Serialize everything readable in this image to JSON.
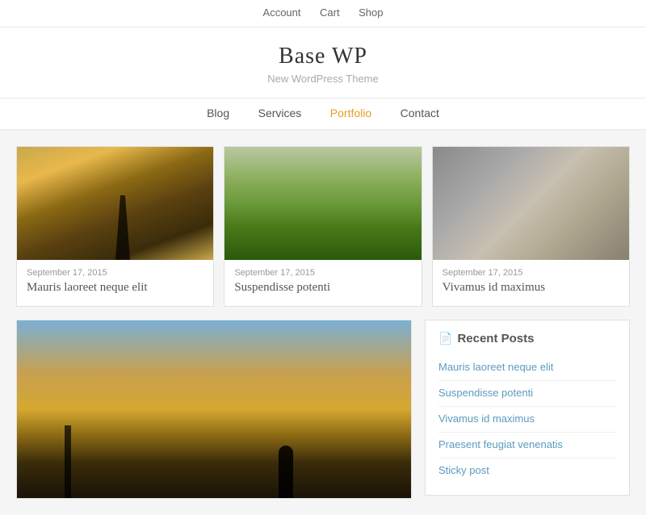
{
  "topbar": {
    "links": [
      {
        "label": "Account",
        "href": "#"
      },
      {
        "label": "Cart",
        "href": "#"
      },
      {
        "label": "Shop",
        "href": "#"
      }
    ]
  },
  "header": {
    "title": "Base WP",
    "subtitle": "New WordPress Theme"
  },
  "nav": {
    "items": [
      {
        "label": "Blog",
        "active": false
      },
      {
        "label": "Services",
        "active": false
      },
      {
        "label": "Portfolio",
        "active": true
      },
      {
        "label": "Contact",
        "active": false
      }
    ]
  },
  "posts_grid": [
    {
      "date": "September 17, 2015",
      "title": "Mauris laoreet neque elit",
      "image_type": "sunset-girl"
    },
    {
      "date": "September 17, 2015",
      "title": "Suspendisse potenti",
      "image_type": "tuscany"
    },
    {
      "date": "September 17, 2015",
      "title": "Vivamus id maximus",
      "image_type": "shells"
    }
  ],
  "featured_post": {
    "image_type": "large-sunset"
  },
  "sidebar": {
    "title": "Recent Posts",
    "icon": "📄",
    "posts": [
      {
        "label": "Mauris laoreet neque elit",
        "href": "#"
      },
      {
        "label": "Suspendisse potenti",
        "href": "#"
      },
      {
        "label": "Vivamus id maximus",
        "href": "#"
      },
      {
        "label": "Praesent feugiat venenatis",
        "href": "#"
      },
      {
        "label": "Sticky post",
        "href": "#"
      }
    ]
  }
}
